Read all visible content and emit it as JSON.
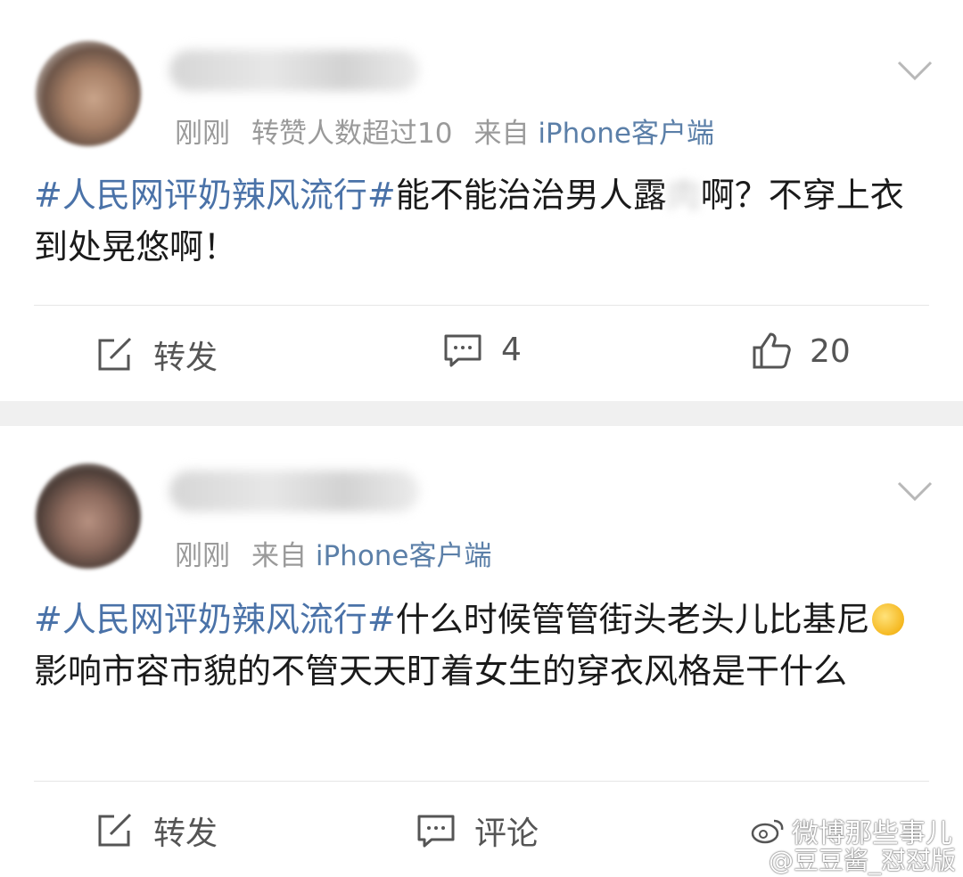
{
  "posts": [
    {
      "meta": {
        "time": "刚刚",
        "extra": "转赞人数超过10",
        "via": "来自",
        "source": "iPhone客户端"
      },
      "body": {
        "hashtag": "#人民网评奶辣风流行#",
        "text_before_blur": "能不能治治男人露",
        "blurred": "肉",
        "text_after_blur": "啊？不穿上衣到处晃悠啊！"
      },
      "actions": {
        "repost": "转发",
        "comment": "4",
        "like": "20"
      }
    },
    {
      "meta": {
        "time": "刚刚",
        "via": "来自",
        "source": "iPhone客户端"
      },
      "body": {
        "hashtag": "#人民网评奶辣风流行#",
        "text_before_emoji": "什么时候管管街头老头儿比基尼",
        "text_after_emoji": "影响市容市貌的不管天天盯着女生的穿衣风格是干什么"
      },
      "actions": {
        "repost": "转发",
        "comment": "评论"
      }
    }
  ],
  "watermark": {
    "line1": "微博那些事儿",
    "line2": "@豆豆酱_怼怼版"
  },
  "icons": {
    "more": "chevron-down-icon",
    "repost": "repost-icon",
    "comment": "comment-icon",
    "like": "thumbs-up-icon",
    "emoji": "thinking-emoji-icon"
  },
  "colors": {
    "hashtag": "#4a72a8",
    "source": "#5b7fa8",
    "meta": "#9a9a9a",
    "separator": "#f0f0f0"
  }
}
